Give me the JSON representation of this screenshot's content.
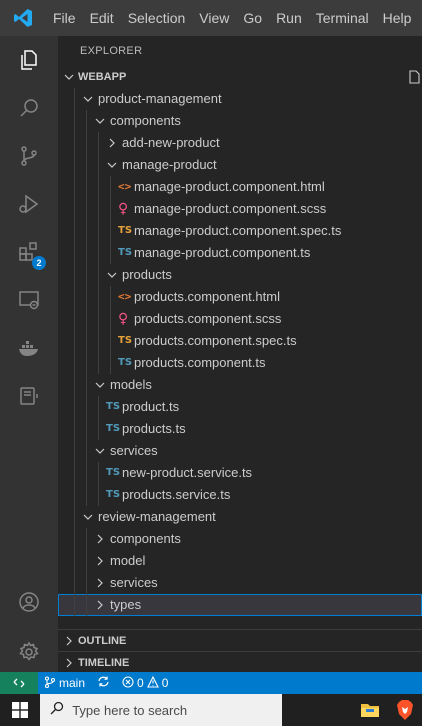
{
  "menu": {
    "items": [
      "File",
      "Edit",
      "Selection",
      "View",
      "Go",
      "Run",
      "Terminal",
      "Help"
    ]
  },
  "activity_bar": {
    "icons": [
      "explorer-icon",
      "search-icon",
      "source-control-icon",
      "run-debug-icon",
      "extensions-icon",
      "remote-explorer-icon",
      "docker-icon",
      "notes-icon",
      "accounts-icon",
      "settings-gear-icon"
    ],
    "extensions_badge": "2"
  },
  "sidebar": {
    "title": "EXPLORER",
    "workspace": "WEBAPP",
    "tree": [
      {
        "label": "product-management",
        "type": "folder",
        "expanded": true,
        "depth": 2
      },
      {
        "label": "components",
        "type": "folder",
        "expanded": true,
        "depth": 3
      },
      {
        "label": "add-new-product",
        "type": "folder",
        "expanded": false,
        "depth": 4
      },
      {
        "label": "manage-product",
        "type": "folder",
        "expanded": true,
        "depth": 4
      },
      {
        "label": "manage-product.component.html",
        "type": "html",
        "depth": 5
      },
      {
        "label": "manage-product.component.scss",
        "type": "scss",
        "depth": 5
      },
      {
        "label": "manage-product.component.spec.ts",
        "type": "spec",
        "depth": 5
      },
      {
        "label": "manage-product.component.ts",
        "type": "ts",
        "depth": 5
      },
      {
        "label": "products",
        "type": "folder",
        "expanded": true,
        "depth": 4
      },
      {
        "label": "products.component.html",
        "type": "html",
        "depth": 5
      },
      {
        "label": "products.component.scss",
        "type": "scss",
        "depth": 5
      },
      {
        "label": "products.component.spec.ts",
        "type": "spec",
        "depth": 5
      },
      {
        "label": "products.component.ts",
        "type": "ts",
        "depth": 5
      },
      {
        "label": "models",
        "type": "folder",
        "expanded": true,
        "depth": 3
      },
      {
        "label": "product.ts",
        "type": "ts",
        "depth": 4
      },
      {
        "label": "products.ts",
        "type": "ts",
        "depth": 4
      },
      {
        "label": "services",
        "type": "folder",
        "expanded": true,
        "depth": 3
      },
      {
        "label": "new-product.service.ts",
        "type": "ts",
        "depth": 4
      },
      {
        "label": "products.service.ts",
        "type": "ts",
        "depth": 4
      },
      {
        "label": "review-management",
        "type": "folder",
        "expanded": true,
        "depth": 2
      },
      {
        "label": "components",
        "type": "folder",
        "expanded": false,
        "depth": 3
      },
      {
        "label": "model",
        "type": "folder",
        "expanded": false,
        "depth": 3
      },
      {
        "label": "services",
        "type": "folder",
        "expanded": false,
        "depth": 3
      },
      {
        "label": "types",
        "type": "folder",
        "expanded": false,
        "depth": 3,
        "selected": true
      }
    ],
    "icon_text": {
      "ts": "TS",
      "spec": "TS",
      "html": "<>",
      "scss": "♀"
    },
    "outline_label": "OUTLINE",
    "timeline_label": "TIMELINE"
  },
  "status_bar": {
    "branch": "main",
    "errors": "0",
    "warnings": "0"
  },
  "taskbar": {
    "search_placeholder": "Type here to search"
  },
  "colors": {
    "accent": "#007acc",
    "remote": "#16825d",
    "ts": "#519aba",
    "spec": "#e5a03a",
    "html": "#e37933",
    "scss": "#f55385"
  }
}
